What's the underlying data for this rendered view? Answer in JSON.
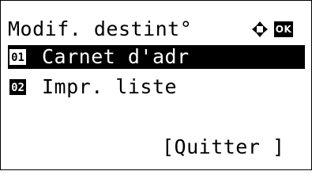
{
  "header": {
    "title": "Modif. destint°",
    "nav_icon": "four-way-arrow-icon",
    "ok_label": "OK"
  },
  "menu": {
    "items": [
      {
        "number": "01",
        "label": "Carnet d'adr",
        "selected": true
      },
      {
        "number": "02",
        "label": "Impr. liste",
        "selected": false
      }
    ]
  },
  "footer": {
    "quit_label": "[Quitter ]"
  },
  "colors": {
    "background": "#ffffff",
    "foreground": "#000000",
    "highlight": "#000000"
  }
}
